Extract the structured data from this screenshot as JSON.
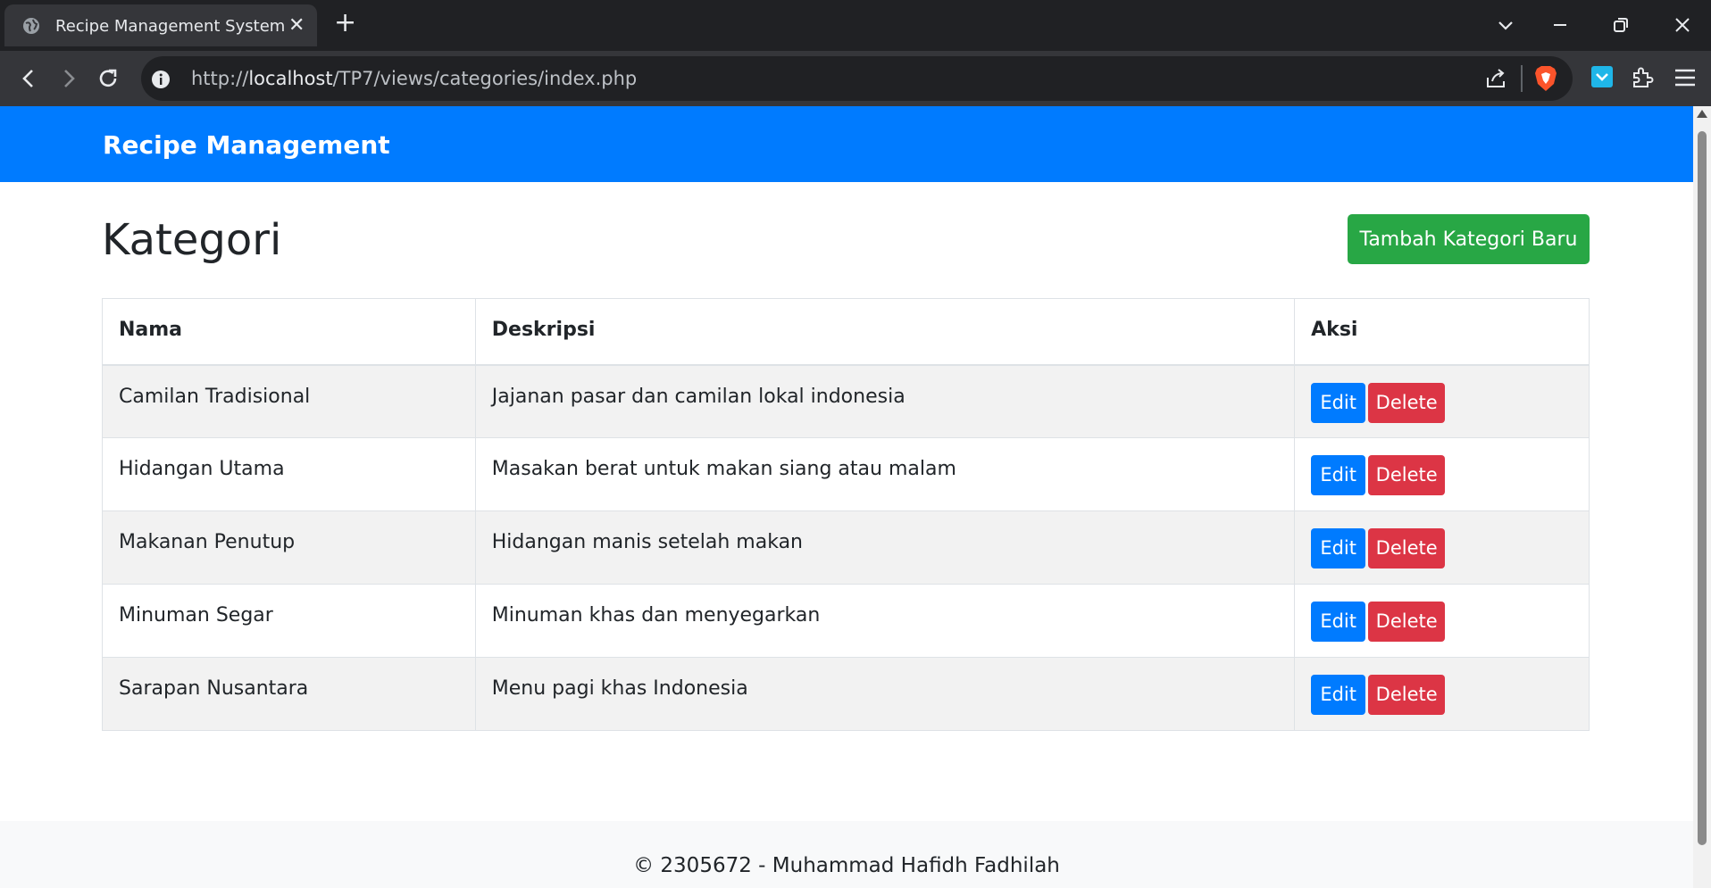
{
  "browser": {
    "tab_title": "Recipe Management System",
    "tab_close": "✕",
    "new_tab": "+",
    "url_prefix": "http://",
    "url_host": "localhost",
    "url_path": "/TP7/views/categories/index.php"
  },
  "navbar": {
    "brand": "Recipe Management",
    "color": "#007bff"
  },
  "main": {
    "title": "Kategori",
    "add_button": "Tambah Kategori Baru",
    "table": {
      "headers": [
        "Nama",
        "Deskripsi",
        "Aksi"
      ],
      "rows": [
        {
          "nama": "Camilan Tradisional",
          "deskripsi": "Jajanan pasar dan camilan lokal indonesia",
          "edit": "Edit",
          "delete": "Delete"
        },
        {
          "nama": "Hidangan Utama",
          "deskripsi": "Masakan berat untuk makan siang atau malam",
          "edit": "Edit",
          "delete": "Delete"
        },
        {
          "nama": "Makanan Penutup",
          "deskripsi": "Hidangan manis setelah makan",
          "edit": "Edit",
          "delete": "Delete"
        },
        {
          "nama": "Minuman Segar",
          "deskripsi": "Minuman khas dan menyegarkan",
          "edit": "Edit",
          "delete": "Delete"
        },
        {
          "nama": "Sarapan Nusantara",
          "deskripsi": "Menu pagi khas Indonesia",
          "edit": "Edit",
          "delete": "Delete"
        }
      ]
    }
  },
  "footer": {
    "text": "© 2305672 - Muhammad Hafidh Fadhilah"
  },
  "colors": {
    "edit": "#007bff",
    "delete": "#dc3545",
    "add": "#28a745"
  }
}
